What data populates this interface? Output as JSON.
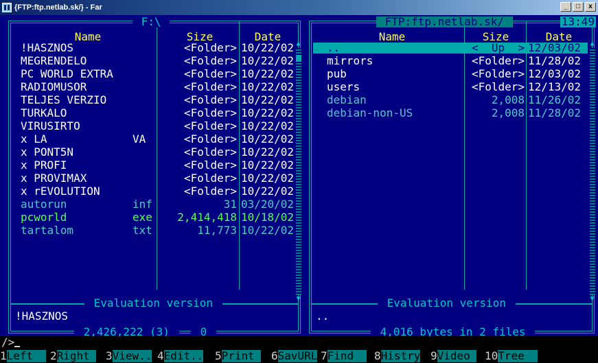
{
  "window": {
    "title": "{FTP:ftp.netlab.sk/} - Far",
    "buttons": [
      "_",
      "□",
      "x"
    ]
  },
  "left_panel": {
    "path": " F:\\ ",
    "columns": {
      "name": "Name",
      "size": "Size",
      "date": "Date"
    },
    "rows": [
      {
        "name": "!HASZNOS",
        "ext": "",
        "size": "<Folder>",
        "date": "10/22/02",
        "color": "white"
      },
      {
        "name": "MEGRENDELO",
        "ext": "",
        "size": "<Folder>",
        "date": "10/22/02",
        "color": "white"
      },
      {
        "name": "PC WORLD EXTRA",
        "ext": "",
        "size": "<Folder>",
        "date": "10/22/02",
        "color": "white"
      },
      {
        "name": "RADIOMUSOR",
        "ext": "",
        "size": "<Folder>",
        "date": "10/22/02",
        "color": "white"
      },
      {
        "name": "TELJES VERZIO",
        "ext": "",
        "size": "<Folder>",
        "date": "10/22/02",
        "color": "white"
      },
      {
        "name": "TURKALO",
        "ext": "",
        "size": "<Folder>",
        "date": "10/22/02",
        "color": "white"
      },
      {
        "name": "VIRUSIRTO",
        "ext": "",
        "size": "<Folder>",
        "date": "10/22/02",
        "color": "white"
      },
      {
        "name": "x LA",
        "ext": "VA",
        "size": "<Folder>",
        "date": "10/22/02",
        "color": "white"
      },
      {
        "name": "x PONT5N",
        "ext": "",
        "size": "<Folder>",
        "date": "10/22/02",
        "color": "white"
      },
      {
        "name": "x PROFI",
        "ext": "",
        "size": "<Folder>",
        "date": "10/22/02",
        "color": "white"
      },
      {
        "name": "x PROVIMAX",
        "ext": "",
        "size": "<Folder>",
        "date": "10/22/02",
        "color": "white"
      },
      {
        "name": "x rEVOLUTION",
        "ext": "",
        "size": "<Folder>",
        "date": "10/22/02",
        "color": "white"
      },
      {
        "name": "autorun",
        "ext": "inf",
        "size": "31",
        "date": "03/20/02",
        "color": "teal"
      },
      {
        "name": "pcworld",
        "ext": "exe",
        "size": "2,414,418",
        "date": "10/18/02",
        "color": "green"
      },
      {
        "name": "tartalom",
        "ext": "txt",
        "size": "11,773",
        "date": "10/22/02",
        "color": "teal"
      }
    ],
    "footer_label": " Evaluation version ",
    "current_item": "!HASZNOS",
    "summary": " 2,426,222 (3) ",
    "selected_count": " 0 "
  },
  "right_panel": {
    "path": " FTP:ftp.netlab.sk/ ",
    "clock": "13:49",
    "columns": {
      "name": "Name",
      "size": "Size",
      "date": "Date"
    },
    "rows": [
      {
        "name": "..",
        "size": "<  Up  >",
        "date": "12/03/02",
        "color": "cursor"
      },
      {
        "name": "mirrors",
        "size": "<Folder>",
        "date": "11/28/02",
        "color": "white"
      },
      {
        "name": "pub",
        "size": "<Folder>",
        "date": "12/03/02",
        "color": "white"
      },
      {
        "name": "users",
        "size": "<Folder>",
        "date": "12/13/02",
        "color": "white"
      },
      {
        "name": "debian",
        "size": "2,008",
        "date": "11/26/02",
        "color": "teal"
      },
      {
        "name": "debian-non-US",
        "size": "2,008",
        "date": "11/28/02",
        "color": "teal"
      }
    ],
    "footer_label": " Evaluation version ",
    "current_item": "..",
    "summary": " 4,016 bytes in 2 files "
  },
  "command_line": {
    "prompt": "/>"
  },
  "keybar": [
    {
      "num": "1",
      "label": "Left  "
    },
    {
      "num": "2",
      "label": "Right "
    },
    {
      "num": "3",
      "label": "View.."
    },
    {
      "num": "4",
      "label": "Edit.."
    },
    {
      "num": "5",
      "label": "Print "
    },
    {
      "num": "6",
      "label": "SavURL"
    },
    {
      "num": "7",
      "label": "Find  "
    },
    {
      "num": "8",
      "label": "Histry"
    },
    {
      "num": "9",
      "label": "Video "
    },
    {
      "num": "10",
      "label": "Tree  "
    }
  ],
  "colors": {
    "background": "#000080",
    "frame": "#00aaaa",
    "header": "#ffff55",
    "folder": "#ffffff",
    "file": "#55c8c8",
    "executable": "#55ff55",
    "cursor_bg": "#00aaaa"
  }
}
